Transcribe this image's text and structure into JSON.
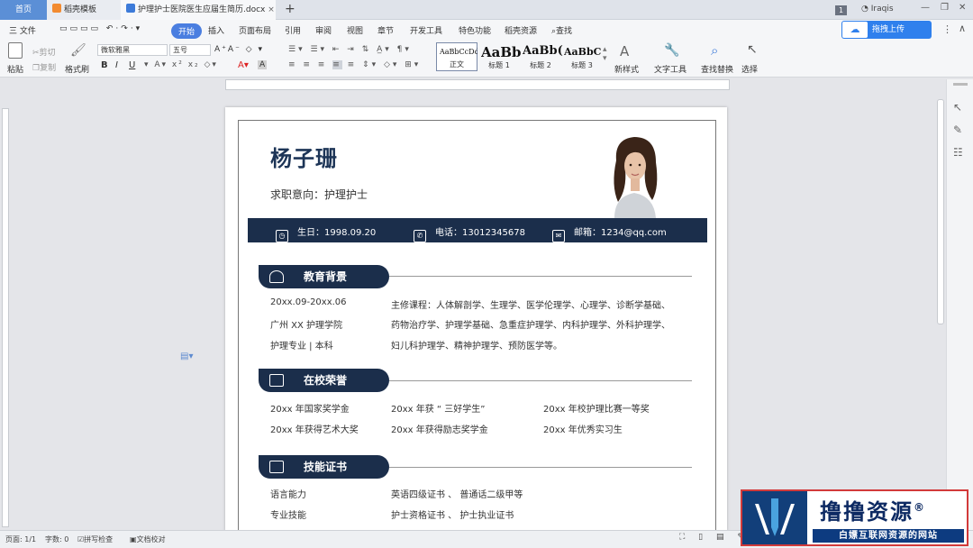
{
  "titlebar": {
    "tab_home": "首页",
    "tab_template": "稻壳模板",
    "tab_doc": "护理护士医院医生应届生简历.docx",
    "user_badge": "1",
    "user_name": "Iraqis"
  },
  "menu": {
    "file": "三 文件",
    "items": [
      "开始",
      "插入",
      "页面布局",
      "引用",
      "审阅",
      "视图",
      "章节",
      "开发工具",
      "特色功能",
      "稻壳资源"
    ],
    "search": "查找",
    "upload_button": "拖拽上传"
  },
  "toolbar": {
    "paste": "粘贴",
    "cut": "剪切",
    "copy": "复制",
    "format_painter": "格式刷",
    "font_name": "微软雅黑",
    "font_size": "五号",
    "bold": "B",
    "italic": "I",
    "underline": "U",
    "styles": [
      {
        "preview": "AaBbCcDd",
        "label": "正文"
      },
      {
        "preview": "AaBb",
        "label": "标题 1"
      },
      {
        "preview": "AaBb(",
        "label": "标题 2"
      },
      {
        "preview": "AaBbC",
        "label": "标题 3"
      }
    ],
    "new_style": "新样式",
    "text_tools": "文字工具",
    "find_replace": "查找替换",
    "select": "选择"
  },
  "resume": {
    "name": "杨子珊",
    "intent": "求职意向：护理护士",
    "birth": "生日：1998.09.20",
    "phone": "电话：13012345678",
    "email": "邮箱：1234@qq.com",
    "education": {
      "title": "教育背景",
      "left": [
        "20xx.09-20xx.06",
        "广州 XX 护理学院",
        "护理专业 | 本科"
      ],
      "right": [
        "主修课程：人体解剖学、生理学、医学伦理学、心理学、诊断学基础、",
        "药物治疗学、护理学基础、急重症护理学、内科护理学、外科护理学、",
        "妇儿科护理学、精神护理学、预防医学等。"
      ]
    },
    "honors": {
      "title": "在校荣誉",
      "rows": [
        [
          "20xx 年国家奖学金",
          "20xx 年获 “ 三好学生”",
          "20xx 年校护理比赛一等奖"
        ],
        [
          "20xx 年获得艺术大奖",
          "20xx 年获得励志奖学金",
          "20xx 年优秀实习生"
        ]
      ]
    },
    "skills": {
      "title": "技能证书",
      "rows": [
        [
          "语言能力",
          "英语四级证书 、 普通话二级甲等"
        ],
        [
          "专业技能",
          "护士资格证书 、 护士执业证书"
        ]
      ]
    }
  },
  "status": {
    "page": "页面: 1/1",
    "words": "字数: 0",
    "spell": "拼写检查",
    "proof": "文档校对"
  },
  "watermark": {
    "title": "撸撸资源",
    "registered": "®",
    "subtitle": "白嫖互联网资源的网站"
  },
  "colors": {
    "navy": "#1b2e4b",
    "accent_blue": "#2f80ed"
  }
}
